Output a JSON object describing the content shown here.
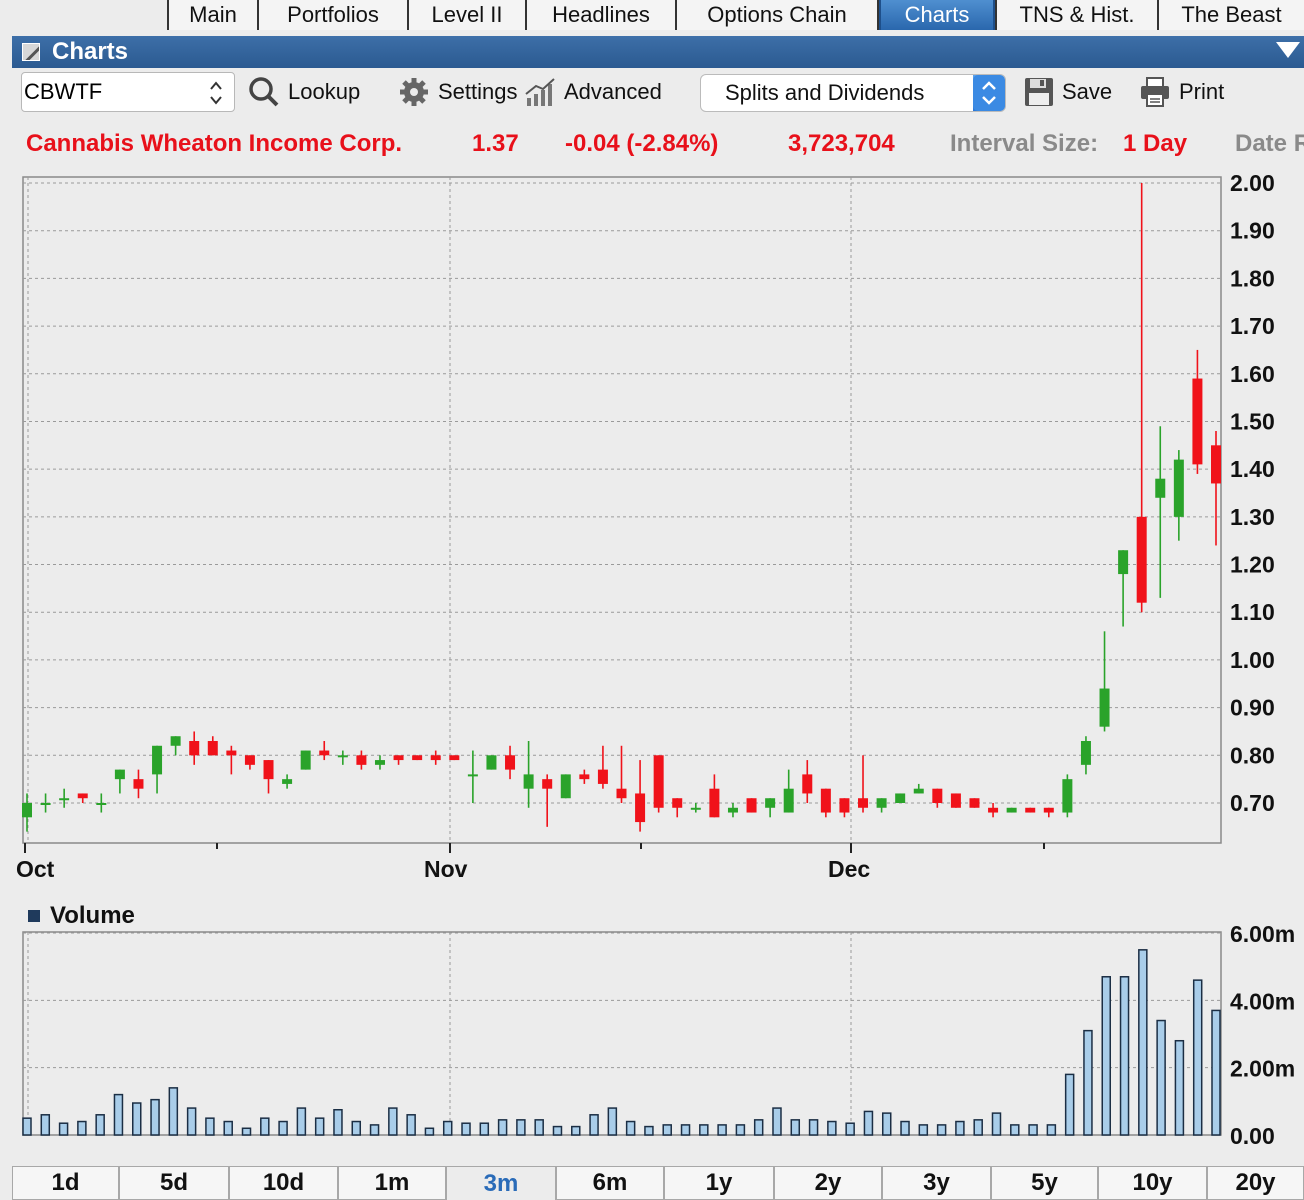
{
  "top_tabs": [
    {
      "label": "Main"
    },
    {
      "label": "Portfolios"
    },
    {
      "label": "Level II"
    },
    {
      "label": "Headlines"
    },
    {
      "label": "Options Chain"
    },
    {
      "label": "Charts",
      "active": true
    },
    {
      "label": "TNS & Hist."
    },
    {
      "label": "The Beast"
    }
  ],
  "window": {
    "title": "Charts"
  },
  "toolbar": {
    "symbol_value": "CBWTF",
    "lookup_label": "Lookup",
    "settings_label": "Settings",
    "advanced_label": "Advanced",
    "splits_selected": "Splits and Dividends",
    "save_label": "Save",
    "print_label": "Print"
  },
  "quote": {
    "name": "Cannabis Wheaton Income Corp.",
    "last": "1.37",
    "change": "-0.04 (-2.84%)",
    "volume": "3,723,704",
    "interval_label": "Interval Size:",
    "interval_value": "1 Day",
    "date_label": "Date R"
  },
  "colors": {
    "up": "#2aa32a",
    "down": "#f0121a",
    "volume_fill": "#a9cde9",
    "volume_stroke": "#1b2e44",
    "grid": "#9a9a9a"
  },
  "volume_panel": {
    "title": "Volume"
  },
  "range_tabs": [
    {
      "label": "1d"
    },
    {
      "label": "5d"
    },
    {
      "label": "10d"
    },
    {
      "label": "1m"
    },
    {
      "label": "3m",
      "active": true
    },
    {
      "label": "6m"
    },
    {
      "label": "1y"
    },
    {
      "label": "2y"
    },
    {
      "label": "3y"
    },
    {
      "label": "5y"
    },
    {
      "label": "10y"
    },
    {
      "label": "20y"
    }
  ],
  "chart_data": [
    {
      "type": "candlestick",
      "x_labels": [
        "Oct",
        "Nov",
        "Dec"
      ],
      "y_ticks": [
        "0.70",
        "0.80",
        "0.90",
        "1.00",
        "1.10",
        "1.20",
        "1.30",
        "1.40",
        "1.50",
        "1.60",
        "1.70",
        "1.80",
        "1.90",
        "2.00"
      ],
      "ylim": [
        0.62,
        2.0
      ],
      "grid": true,
      "series": [
        {
          "o": 0.67,
          "h": 0.72,
          "l": 0.64,
          "c": 0.7
        },
        {
          "o": 0.7,
          "h": 0.72,
          "l": 0.68,
          "c": 0.7
        },
        {
          "o": 0.71,
          "h": 0.73,
          "l": 0.69,
          "c": 0.71
        },
        {
          "o": 0.72,
          "h": 0.72,
          "l": 0.7,
          "c": 0.71
        },
        {
          "o": 0.7,
          "h": 0.72,
          "l": 0.68,
          "c": 0.7
        },
        {
          "o": 0.75,
          "h": 0.77,
          "l": 0.72,
          "c": 0.77
        },
        {
          "o": 0.75,
          "h": 0.77,
          "l": 0.71,
          "c": 0.73
        },
        {
          "o": 0.76,
          "h": 0.82,
          "l": 0.72,
          "c": 0.82
        },
        {
          "o": 0.82,
          "h": 0.84,
          "l": 0.8,
          "c": 0.84
        },
        {
          "o": 0.83,
          "h": 0.85,
          "l": 0.78,
          "c": 0.8
        },
        {
          "o": 0.83,
          "h": 0.84,
          "l": 0.8,
          "c": 0.8
        },
        {
          "o": 0.81,
          "h": 0.82,
          "l": 0.76,
          "c": 0.8
        },
        {
          "o": 0.8,
          "h": 0.8,
          "l": 0.77,
          "c": 0.78
        },
        {
          "o": 0.79,
          "h": 0.79,
          "l": 0.72,
          "c": 0.75
        },
        {
          "o": 0.74,
          "h": 0.76,
          "l": 0.73,
          "c": 0.75
        },
        {
          "o": 0.77,
          "h": 0.81,
          "l": 0.77,
          "c": 0.81
        },
        {
          "o": 0.81,
          "h": 0.83,
          "l": 0.79,
          "c": 0.8
        },
        {
          "o": 0.8,
          "h": 0.81,
          "l": 0.78,
          "c": 0.8
        },
        {
          "o": 0.8,
          "h": 0.81,
          "l": 0.77,
          "c": 0.78
        },
        {
          "o": 0.78,
          "h": 0.8,
          "l": 0.77,
          "c": 0.79
        },
        {
          "o": 0.8,
          "h": 0.8,
          "l": 0.78,
          "c": 0.79
        },
        {
          "o": 0.8,
          "h": 0.8,
          "l": 0.79,
          "c": 0.79
        },
        {
          "o": 0.8,
          "h": 0.81,
          "l": 0.78,
          "c": 0.79
        },
        {
          "o": 0.8,
          "h": 0.8,
          "l": 0.79,
          "c": 0.79
        },
        {
          "o": 0.76,
          "h": 0.81,
          "l": 0.7,
          "c": 0.76
        },
        {
          "o": 0.77,
          "h": 0.8,
          "l": 0.77,
          "c": 0.8
        },
        {
          "o": 0.8,
          "h": 0.82,
          "l": 0.75,
          "c": 0.77
        },
        {
          "o": 0.73,
          "h": 0.83,
          "l": 0.69,
          "c": 0.76
        },
        {
          "o": 0.75,
          "h": 0.76,
          "l": 0.65,
          "c": 0.73
        },
        {
          "o": 0.71,
          "h": 0.76,
          "l": 0.71,
          "c": 0.76
        },
        {
          "o": 0.76,
          "h": 0.77,
          "l": 0.74,
          "c": 0.75
        },
        {
          "o": 0.77,
          "h": 0.82,
          "l": 0.73,
          "c": 0.74
        },
        {
          "o": 0.73,
          "h": 0.82,
          "l": 0.7,
          "c": 0.71
        },
        {
          "o": 0.72,
          "h": 0.79,
          "l": 0.64,
          "c": 0.66
        },
        {
          "o": 0.8,
          "h": 0.8,
          "l": 0.68,
          "c": 0.69
        },
        {
          "o": 0.71,
          "h": 0.71,
          "l": 0.67,
          "c": 0.69
        },
        {
          "o": 0.69,
          "h": 0.7,
          "l": 0.68,
          "c": 0.69
        },
        {
          "o": 0.73,
          "h": 0.76,
          "l": 0.67,
          "c": 0.67
        },
        {
          "o": 0.68,
          "h": 0.7,
          "l": 0.67,
          "c": 0.69
        },
        {
          "o": 0.71,
          "h": 0.71,
          "l": 0.68,
          "c": 0.68
        },
        {
          "o": 0.69,
          "h": 0.71,
          "l": 0.67,
          "c": 0.71
        },
        {
          "o": 0.68,
          "h": 0.77,
          "l": 0.68,
          "c": 0.73
        },
        {
          "o": 0.76,
          "h": 0.79,
          "l": 0.7,
          "c": 0.72
        },
        {
          "o": 0.73,
          "h": 0.73,
          "l": 0.67,
          "c": 0.68
        },
        {
          "o": 0.71,
          "h": 0.71,
          "l": 0.67,
          "c": 0.68
        },
        {
          "o": 0.71,
          "h": 0.8,
          "l": 0.68,
          "c": 0.69
        },
        {
          "o": 0.69,
          "h": 0.71,
          "l": 0.68,
          "c": 0.71
        },
        {
          "o": 0.7,
          "h": 0.72,
          "l": 0.7,
          "c": 0.72
        },
        {
          "o": 0.72,
          "h": 0.74,
          "l": 0.72,
          "c": 0.73
        },
        {
          "o": 0.73,
          "h": 0.73,
          "l": 0.69,
          "c": 0.7
        },
        {
          "o": 0.72,
          "h": 0.72,
          "l": 0.69,
          "c": 0.69
        },
        {
          "o": 0.71,
          "h": 0.71,
          "l": 0.69,
          "c": 0.69
        },
        {
          "o": 0.69,
          "h": 0.7,
          "l": 0.67,
          "c": 0.68
        },
        {
          "o": 0.68,
          "h": 0.69,
          "l": 0.68,
          "c": 0.69
        },
        {
          "o": 0.69,
          "h": 0.69,
          "l": 0.68,
          "c": 0.68
        },
        {
          "o": 0.69,
          "h": 0.69,
          "l": 0.67,
          "c": 0.68
        },
        {
          "o": 0.68,
          "h": 0.76,
          "l": 0.67,
          "c": 0.75
        },
        {
          "o": 0.78,
          "h": 0.84,
          "l": 0.76,
          "c": 0.83
        },
        {
          "o": 0.86,
          "h": 1.06,
          "l": 0.85,
          "c": 0.94
        },
        {
          "o": 1.18,
          "h": 1.23,
          "l": 1.07,
          "c": 1.23
        },
        {
          "o": 1.3,
          "h": 2.0,
          "l": 1.1,
          "c": 1.12
        },
        {
          "o": 1.34,
          "h": 1.49,
          "l": 1.13,
          "c": 1.38
        },
        {
          "o": 1.3,
          "h": 1.44,
          "l": 1.25,
          "c": 1.42
        },
        {
          "o": 1.59,
          "h": 1.65,
          "l": 1.39,
          "c": 1.41
        },
        {
          "o": 1.45,
          "h": 1.48,
          "l": 1.24,
          "c": 1.37
        }
      ]
    },
    {
      "type": "bar",
      "title": "Volume",
      "y_ticks": [
        "0.00",
        "2.00m",
        "4.00m",
        "6.00m"
      ],
      "ylim": [
        0,
        6000000
      ],
      "values": [
        500000,
        600000,
        350000,
        400000,
        600000,
        1200000,
        950000,
        1050000,
        1400000,
        800000,
        500000,
        400000,
        200000,
        500000,
        400000,
        800000,
        500000,
        750000,
        400000,
        300000,
        800000,
        600000,
        200000,
        400000,
        350000,
        350000,
        450000,
        450000,
        450000,
        250000,
        250000,
        600000,
        800000,
        400000,
        250000,
        300000,
        300000,
        300000,
        300000,
        300000,
        450000,
        800000,
        450000,
        450000,
        400000,
        350000,
        700000,
        650000,
        400000,
        300000,
        300000,
        400000,
        450000,
        650000,
        300000,
        300000,
        300000,
        1800000,
        3100000,
        4700000,
        4700000,
        5500000,
        3400000,
        2800000,
        4600000,
        3700000
      ]
    }
  ]
}
